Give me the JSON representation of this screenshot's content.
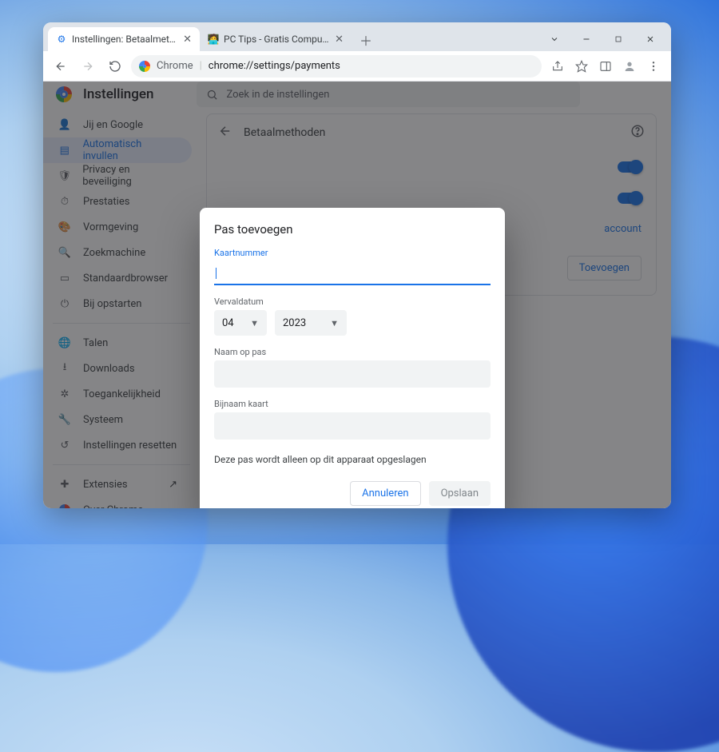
{
  "window": {
    "tabs": [
      {
        "title": "Instellingen: Betaalmethoden",
        "favicon": "gear-blue"
      },
      {
        "title": "PC Tips - Gratis Computer Tips, i",
        "favicon": "pctips"
      }
    ]
  },
  "toolbar": {
    "url_scheme": "Chrome",
    "url_path": "chrome://settings/payments"
  },
  "settings": {
    "title": "Instellingen",
    "search_placeholder": "Zoek in de instellingen",
    "sidebar": {
      "items": [
        {
          "label": "Jij en Google",
          "icon": "person"
        },
        {
          "label": "Automatisch invullen",
          "icon": "autofill",
          "active": true
        },
        {
          "label": "Privacy en beveiliging",
          "icon": "shield"
        },
        {
          "label": "Prestaties",
          "icon": "speed"
        },
        {
          "label": "Vormgeving",
          "icon": "palette"
        },
        {
          "label": "Zoekmachine",
          "icon": "search"
        },
        {
          "label": "Standaardbrowser",
          "icon": "browser"
        },
        {
          "label": "Bij opstarten",
          "icon": "power"
        }
      ],
      "more": [
        {
          "label": "Talen",
          "icon": "globe"
        },
        {
          "label": "Downloads",
          "icon": "download"
        },
        {
          "label": "Toegankelijkheid",
          "icon": "accessibility"
        },
        {
          "label": "Systeem",
          "icon": "wrench"
        },
        {
          "label": "Instellingen resetten",
          "icon": "reset"
        }
      ],
      "footer": [
        {
          "label": "Extensies",
          "icon": "extension",
          "external": true
        },
        {
          "label": "Over Chrome",
          "icon": "chrome"
        }
      ]
    },
    "page": {
      "title": "Betaalmethoden",
      "account_link_suffix": "account",
      "add_button": "Toevoegen"
    }
  },
  "dialog": {
    "title": "Pas toevoegen",
    "card_number_label": "Kaartnummer",
    "card_number_value": "",
    "expiry_label": "Vervaldatum",
    "expiry_month": "04",
    "expiry_year": "2023",
    "name_label": "Naam op pas",
    "name_value": "",
    "nickname_label": "Bijnaam kaart",
    "nickname_value": "",
    "helper": "Deze pas wordt alleen op dit apparaat opgeslagen",
    "cancel": "Annuleren",
    "save": "Opslaan"
  }
}
